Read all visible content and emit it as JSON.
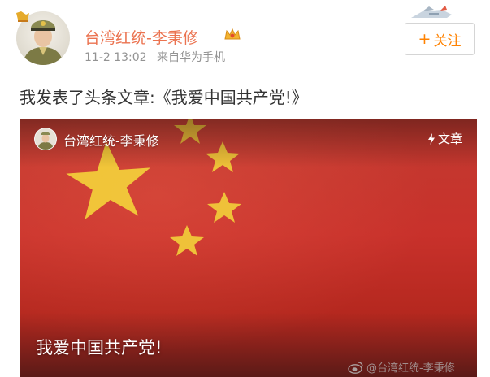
{
  "post": {
    "username": "台湾红统-李秉修",
    "timestamp": "11-2 13:02",
    "source": "来自华为手机",
    "follow_label": "关注",
    "text": "我发表了头条文章:《我爱中国共产党!》"
  },
  "article": {
    "author": "台湾红统-李秉修",
    "tag": "文章",
    "title": "我爱中国共产党!",
    "watermark": "@台湾红统-李秉修"
  },
  "colors": {
    "username": "#eb7350",
    "follow": "#ff8200",
    "meta": "#939393",
    "flag_red": "#c8312b",
    "flag_star": "#f5d23a"
  },
  "icons": {
    "vip": "vip-crown-icon",
    "follow": "plus-icon",
    "tag": "bolt-icon",
    "watermark": "weibo-logo-icon"
  }
}
